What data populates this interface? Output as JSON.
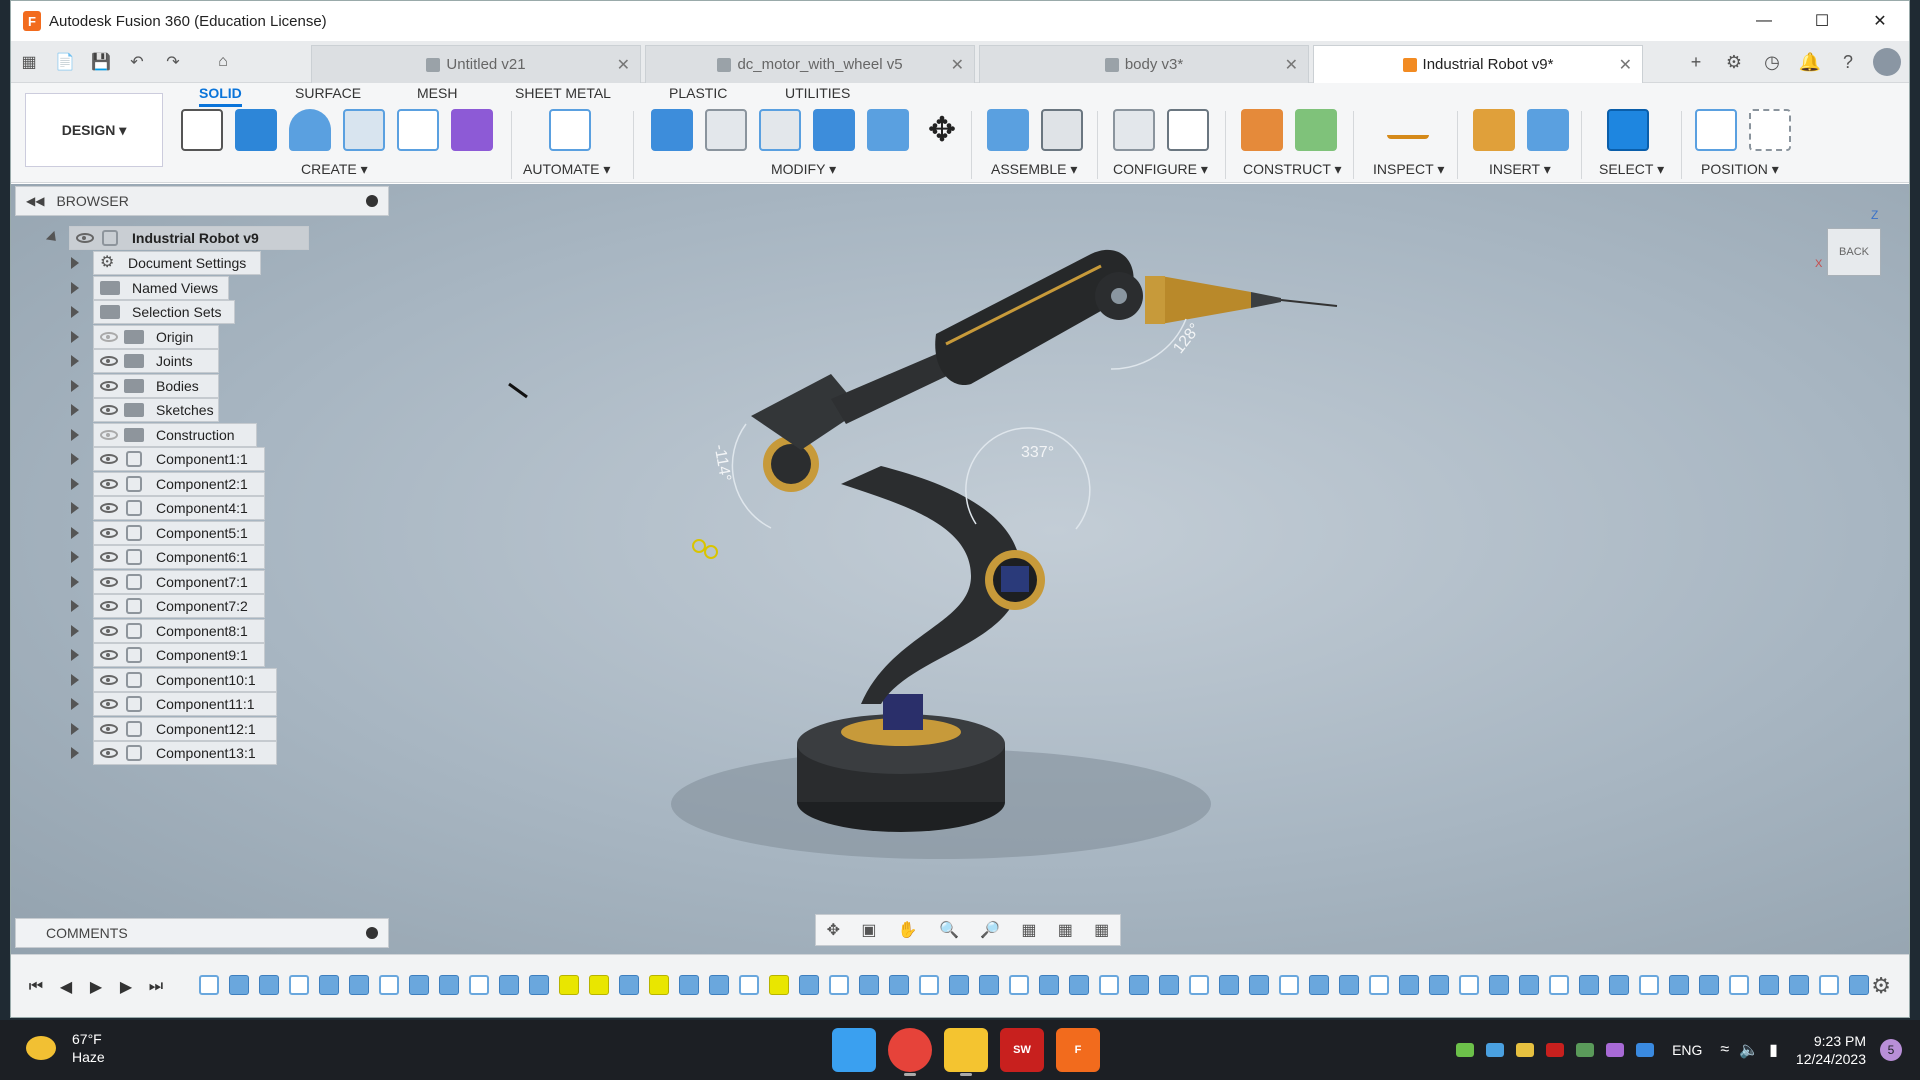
{
  "window": {
    "title": "Autodesk Fusion 360 (Education License)",
    "app_badge": "F"
  },
  "tabs": [
    {
      "label": "Untitled v21",
      "active": false
    },
    {
      "label": "dc_motor_with_wheel v5",
      "active": false
    },
    {
      "label": "body v3*",
      "active": false
    },
    {
      "label": "Industrial Robot v9*",
      "active": true
    }
  ],
  "ribbon": {
    "design_label": "DESIGN ▾",
    "workspace_tabs": [
      "SOLID",
      "SURFACE",
      "MESH",
      "SHEET METAL",
      "PLASTIC",
      "UTILITIES"
    ],
    "groups": [
      "CREATE ▾",
      "AUTOMATE ▾",
      "MODIFY ▾",
      "ASSEMBLE ▾",
      "CONFIGURE ▾",
      "CONSTRUCT ▾",
      "INSPECT ▾",
      "INSERT ▾",
      "SELECT ▾",
      "POSITION ▾"
    ]
  },
  "browser": {
    "header": "BROWSER",
    "root": "Industrial Robot v9",
    "items": [
      {
        "label": "Document Settings",
        "kind": "settings"
      },
      {
        "label": "Named Views",
        "kind": "folder"
      },
      {
        "label": "Selection Sets",
        "kind": "folder"
      },
      {
        "label": "Origin",
        "kind": "folder-eye-off"
      },
      {
        "label": "Joints",
        "kind": "folder-eye"
      },
      {
        "label": "Bodies",
        "kind": "folder-eye"
      },
      {
        "label": "Sketches",
        "kind": "folder-eye"
      },
      {
        "label": "Construction",
        "kind": "folder-eye-off"
      },
      {
        "label": "Component1:1",
        "kind": "component"
      },
      {
        "label": "Component2:1",
        "kind": "component"
      },
      {
        "label": "Component4:1",
        "kind": "component"
      },
      {
        "label": "Component5:1",
        "kind": "component"
      },
      {
        "label": "Component6:1",
        "kind": "component"
      },
      {
        "label": "Component7:1",
        "kind": "component"
      },
      {
        "label": "Component7:2",
        "kind": "component"
      },
      {
        "label": "Component8:1",
        "kind": "component"
      },
      {
        "label": "Component9:1",
        "kind": "component"
      },
      {
        "label": "Component10:1",
        "kind": "component"
      },
      {
        "label": "Component11:1",
        "kind": "component"
      },
      {
        "label": "Component12:1",
        "kind": "component"
      },
      {
        "label": "Component13:1",
        "kind": "component"
      }
    ]
  },
  "comments": {
    "label": "COMMENTS"
  },
  "viewport": {
    "angles": [
      "128°",
      "337°",
      "-114°"
    ],
    "viewcube": {
      "face": "BACK",
      "z": "Z",
      "x": "X"
    }
  },
  "taskbar": {
    "weather_temp": "67°F",
    "weather_desc": "Haze",
    "lang": "ENG",
    "time": "9:23 PM",
    "date": "12/24/2023",
    "notification_count": "5",
    "apps": [
      {
        "name": "windows-start",
        "label": "",
        "color": "#3aa0f0"
      },
      {
        "name": "chrome",
        "label": "",
        "color": "#e6433a"
      },
      {
        "name": "file-explorer",
        "label": "",
        "color": "#f4c430"
      },
      {
        "name": "solidworks",
        "label": "SW",
        "color": "#c8201e"
      },
      {
        "name": "fusion-360",
        "label": "F",
        "color": "#f26b1d"
      }
    ]
  },
  "colors": {
    "accent": "#0a74da",
    "fusion": "#f26b1d",
    "robot_body": "#2b2d2f",
    "robot_accent": "#c79a3a"
  }
}
